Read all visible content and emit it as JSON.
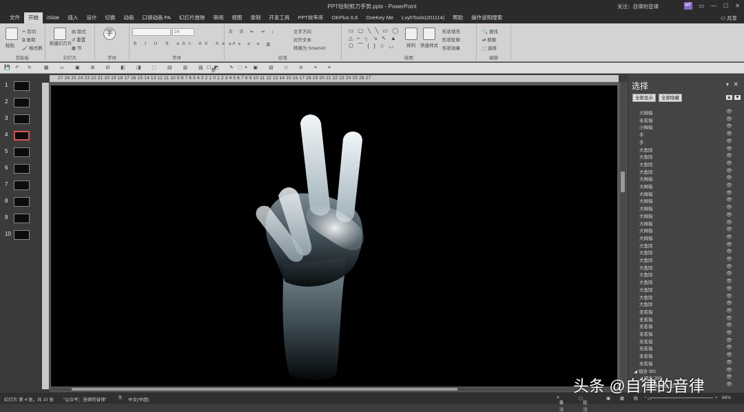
{
  "window": {
    "doc_title": "PPT绘制剪刀手势.pptx - PowerPoint",
    "account": "关注：自律的音律",
    "avatar": "WF",
    "share": "共享"
  },
  "tabs": [
    "文件",
    "开始",
    "iSlide",
    "插入",
    "设计",
    "切换",
    "动画",
    "口袋动画 PA",
    "幻灯片放映",
    "审阅",
    "视图",
    "录制",
    "开发工具",
    "PPT效率库",
    "OKPlus 6.6",
    "OneKey Me",
    "LvyhTools(201114)",
    "帮助",
    "操作说明搜索"
  ],
  "active_tab": "开始",
  "ribbon": {
    "groups": [
      "剪贴板",
      "幻灯片",
      "字体",
      "段落",
      "绘图",
      "编辑"
    ],
    "paste": "粘贴",
    "cut": "剪切",
    "copy": "复制",
    "format_painter": "格式刷",
    "new_slide": "新建幻灯片",
    "layout": "版式",
    "reset": "重置",
    "section": "节",
    "font_char": "字",
    "font_size": "24",
    "vertical_text": "文字方向",
    "align_text": "对齐文本",
    "smartart": "转换为 SmartArt",
    "arrange": "排列",
    "quick_styles": "快速样式",
    "fill": "形状填充",
    "outline": "形状轮廓",
    "effects": "形状效果",
    "find": "查找",
    "replace": "替换",
    "select": "选择",
    "font_group2": "字体"
  },
  "fmtbar": {
    "reference_line": "参考线"
  },
  "slides": [
    1,
    2,
    3,
    4,
    5,
    6,
    7,
    8,
    9,
    10
  ],
  "selected_slide": 4,
  "ruler_text": "27 26 25 24 23 22 21 20 19 18 17 16 15 14 13 12 11 10 9 8 7 6 5 4 3 2 1 0 1 2 3 4 5 6 7 8 9 10 11 12 13 14 15 16 17 18 19 20 21 22 23 24 25 26 27",
  "pane": {
    "title": "选择",
    "show_all": "全部显示",
    "hide_all": "全部隐藏",
    "layers": [
      "大拇指",
      "无名指",
      "小拇指",
      "手",
      "手",
      "大鱼际",
      "大鱼际",
      "大鱼际",
      "大鱼际",
      "大拇指",
      "大拇指",
      "大拇指",
      "大拇指",
      "大拇指",
      "大拇指",
      "大拇指",
      "大拇指",
      "大拇指",
      "大鱼际",
      "大鱼际",
      "大鱼际",
      "大鱼际",
      "大鱼际",
      "大鱼际",
      "大鱼际",
      "大鱼际",
      "大鱼际",
      "无名指",
      "无名指",
      "无名指",
      "无名指",
      "无名指",
      "无名指",
      "无名指",
      "无名指"
    ],
    "group1": "组合 391",
    "group2": "组合 393",
    "group3": "任意多边形: 形状 411"
  },
  "status": {
    "slide_info": "幻灯片 第 4 张，共 10 张",
    "note": "\"公众号：自律的音律\"",
    "lang": "中文(中国)",
    "notes": "备注",
    "comments": "批注",
    "zoom": "66%"
  },
  "watermark": "头条 @自律的音律"
}
